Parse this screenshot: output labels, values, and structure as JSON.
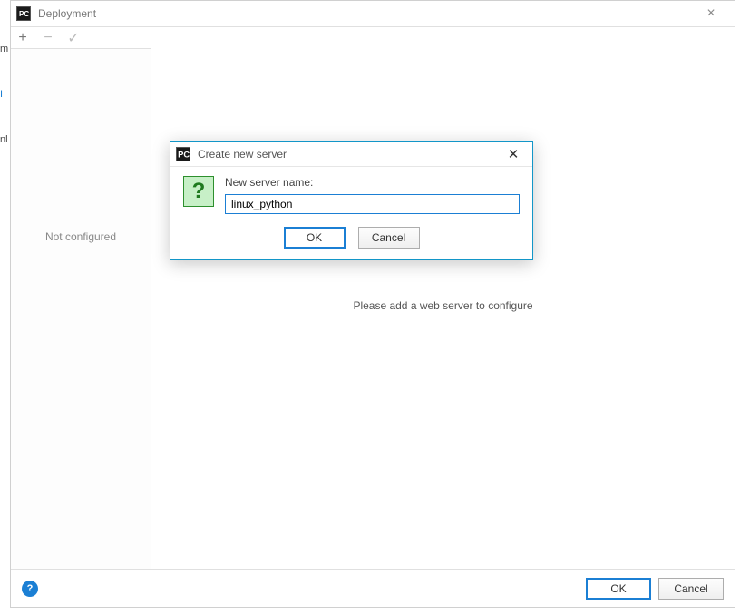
{
  "window": {
    "title": "Deployment",
    "close_glyph": "×"
  },
  "toolbar": {
    "add_glyph": "+",
    "remove_glyph": "−",
    "check_glyph": "✓"
  },
  "sidebar": {
    "not_configured": "Not configured"
  },
  "main": {
    "placeholder": "Please add a web server to configure"
  },
  "footer": {
    "help_glyph": "?",
    "ok_label": "OK",
    "cancel_label": "Cancel"
  },
  "modal": {
    "title": "Create new server",
    "close_glyph": "✕",
    "question_glyph": "?",
    "label": "New server name:",
    "value": "linux_python",
    "ok_label": "OK",
    "cancel_label": "Cancel"
  },
  "gutter": {
    "g1": "m",
    "g2": "I",
    "g3": "nl"
  }
}
